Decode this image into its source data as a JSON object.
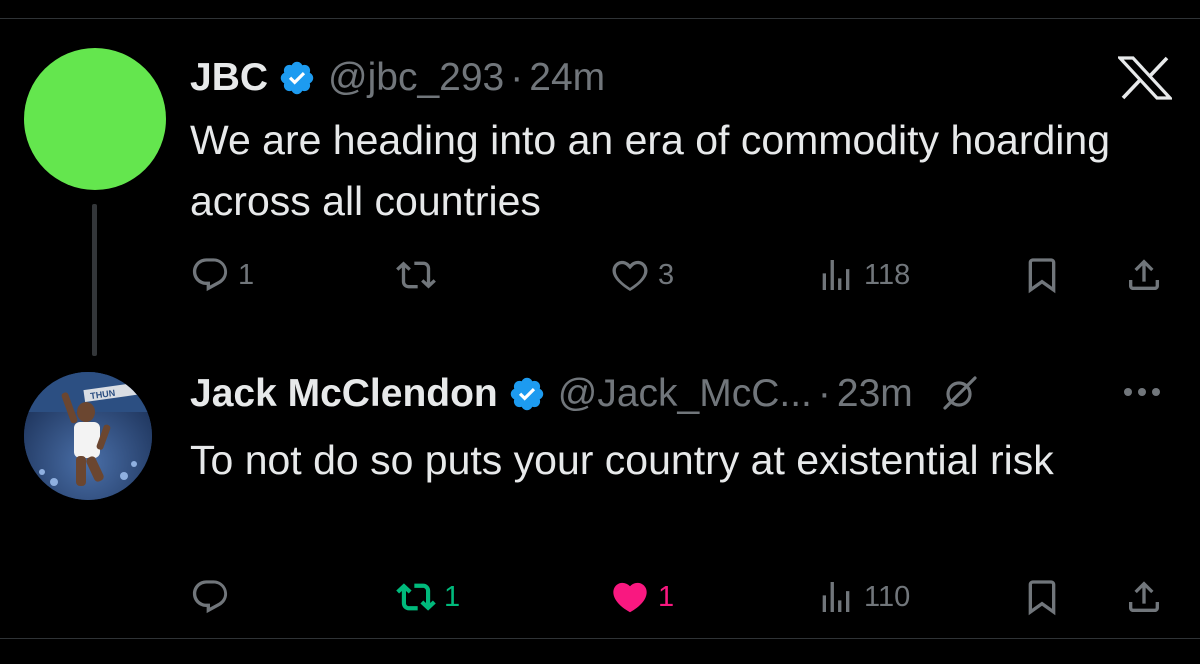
{
  "tweets": [
    {
      "name": "JBC",
      "handle": "@jbc_293",
      "separator": "·",
      "time": "24m",
      "text": "We are heading into an era of commodity hoarding across all countries",
      "avatar_color": "#64e64e",
      "actions": {
        "replies": "1",
        "retweets": "",
        "likes": "3",
        "views": "118"
      }
    },
    {
      "name": "Jack McClendon",
      "handle": "@Jack_McC...",
      "separator": "·",
      "time": "23m",
      "text": "To not do so puts your country at existential risk",
      "avatar_label": "THUN",
      "actions": {
        "replies": "",
        "retweets": "1",
        "likes": "1",
        "views": "110"
      },
      "retweeted": true,
      "liked": true
    }
  ],
  "icons": [
    "x-logo-icon",
    "verified-badge-icon",
    "reply-icon",
    "retweet-icon",
    "like-icon",
    "views-icon",
    "bookmark-icon",
    "share-icon",
    "grok-icon",
    "more-icon"
  ],
  "colors": {
    "background": "#000000",
    "text": "#e7e9ea",
    "muted": "#71767b",
    "verified": "#1d9bf0",
    "retweet_active": "#00ba7c",
    "like_active": "#f91880"
  }
}
